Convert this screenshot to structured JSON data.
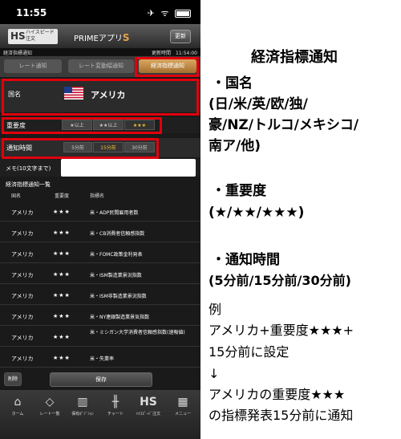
{
  "status_bar": {
    "time": "11:55",
    "icons": "✈ ᯤ"
  },
  "app": {
    "logo_mark": "HS",
    "logo_line1": "ハイスピード",
    "logo_line2": "注文",
    "title": "PRIMEアプリ",
    "title_accent": "S",
    "refresh_label": "更新"
  },
  "subheader": {
    "left": "経済指標通知",
    "right": "更新時間　11:54:00"
  },
  "tabs": [
    "レート通知",
    "レート変動幅通知",
    "経済指標通知"
  ],
  "form": {
    "country_label": "国名",
    "country_value": "アメリカ",
    "importance_label": "重要度",
    "importance_options": [
      "★以上",
      "★★以上",
      "★★★"
    ],
    "importance_selected": 2,
    "time_label": "通知時間",
    "time_options": [
      "5分前",
      "15分前",
      "30分前"
    ],
    "time_selected": 1,
    "memo_label": "メモ(10文字まで)",
    "memo_value": ""
  },
  "list": {
    "title": "経済指標通知一覧",
    "headers": [
      "国名",
      "重要度",
      "指標名"
    ],
    "rows": [
      {
        "country": "アメリカ",
        "importance": "★★★",
        "name": "米・ADP民間雇用者数"
      },
      {
        "country": "アメリカ",
        "importance": "★★★",
        "name": "米・CB消費者信頼感指数"
      },
      {
        "country": "アメリカ",
        "importance": "★★★",
        "name": "米・FOMC政策金利発表"
      },
      {
        "country": "アメリカ",
        "importance": "★★★",
        "name": "米・ISM製造業景況指数"
      },
      {
        "country": "アメリカ",
        "importance": "★★★",
        "name": "米・ISM非製造業景況指数"
      },
      {
        "country": "アメリカ",
        "importance": "★★★",
        "name": "米・NY連銀製造業景気指数"
      },
      {
        "country": "アメリカ",
        "importance": "★★★",
        "name": "米・ミシガン大学消費者信頼感指数(速報値)"
      },
      {
        "country": "アメリカ",
        "importance": "★★★",
        "name": "米・失業率"
      }
    ]
  },
  "actions": {
    "delete_label": "削除",
    "save_label": "保存"
  },
  "nav": [
    {
      "icon": "home-icon",
      "label": "ホーム"
    },
    {
      "icon": "rate-list-icon",
      "label": "レート一覧"
    },
    {
      "icon": "position-icon",
      "label": "保有ﾎﾟｼﾞｼｮﾝ"
    },
    {
      "icon": "chart-icon",
      "label": "チャート"
    },
    {
      "icon": "hs-icon",
      "label": "ﾊｲｽﾋﾟｰﾄﾞ注文"
    },
    {
      "icon": "menu-icon",
      "label": "メニュー"
    }
  ],
  "panel": {
    "title": "経済指標通知",
    "country_heading": "・国名",
    "country_desc_1": "(日/米/英/欧/独/",
    "country_desc_2": "豪/NZ/トルコ/メキシコ/",
    "country_desc_3": "南ア/他)",
    "importance_heading": "・重要度",
    "importance_desc": "(★/★★/★★★)",
    "time_heading": "・通知時間",
    "time_desc": "(5分前/15分前/30分前)",
    "example_1": "例",
    "example_2": "アメリカ+重要度★★★+",
    "example_3": "15分前に設定",
    "example_4": "↓",
    "example_5": "アメリカの重要度★★★",
    "example_6": "の指標発表15分前に通知"
  },
  "colors": {
    "highlight": "#e0000c",
    "accent_tab": "#c68a3d",
    "selected_star": "#f3c131"
  }
}
